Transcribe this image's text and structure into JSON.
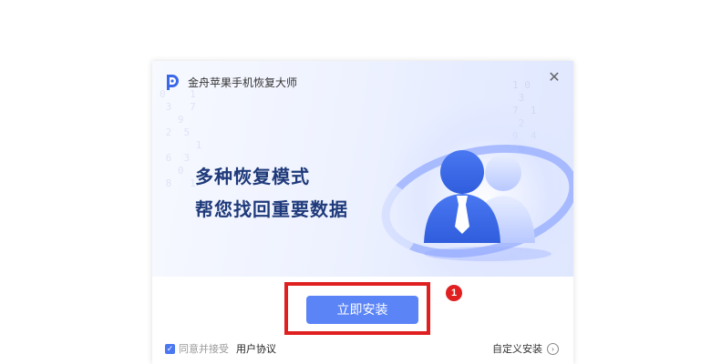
{
  "window": {
    "title": "金舟苹果手机恢复大师",
    "close_glyph": "✕"
  },
  "hero": {
    "headline_1": "多种恢复模式",
    "headline_2": "帮您找回重要数据"
  },
  "actions": {
    "install_label": "立即安装",
    "custom_install_label": "自定义安装",
    "custom_install_icon": "arrow-right-circle-icon"
  },
  "agreement": {
    "checked": true,
    "check_glyph": "✓",
    "prefix": "同意并接受",
    "link_label": "用户协议"
  },
  "annotation": {
    "step_number": "1",
    "highlight_color": "#e02020"
  },
  "colors": {
    "accent": "#5b84f7",
    "headline": "#1f3a7a"
  }
}
